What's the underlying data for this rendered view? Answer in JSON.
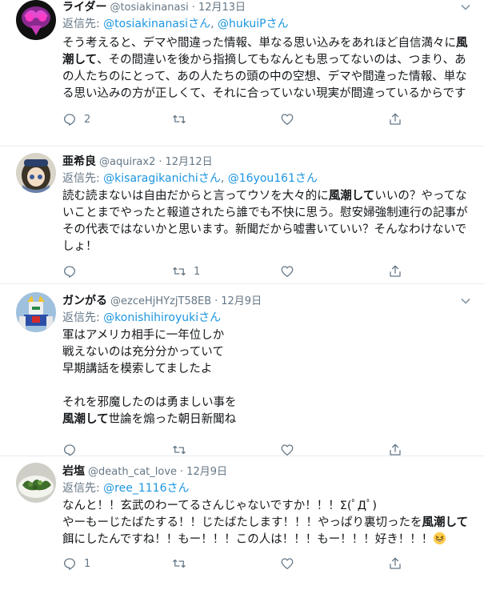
{
  "tweets": [
    {
      "name": "ライダー",
      "handle": "@tosiakinanasi",
      "date": "12月13日",
      "reply_prefix": "返信先: ",
      "reply_users": [
        "@tosiakinanasiさん",
        "@hukuiPさん"
      ],
      "reply_sep": ", ",
      "segments": [
        {
          "t": "そう考えると、デマや間違った情報、単なる思い込みをあれほど自信満々に",
          "b": false
        },
        {
          "t": "風潮して",
          "b": true
        },
        {
          "t": "、その間違いを後から指摘してもなんとも思ってないのは、つまり、あの人たちのにとって、あの人たちの頭の中の空想、デマや間違った情報、単なる思い込みの方が正しくて、それに合っていない現実が間違っているからです",
          "b": false
        }
      ],
      "reply_count": "2",
      "retweet_count": "",
      "like_count": "",
      "avatar_icon": "masked-rider-avatar-icon"
    },
    {
      "name": "亜希良",
      "handle": "@aquirax2",
      "date": "12月12日",
      "reply_prefix": "返信先: ",
      "reply_users": [
        "@kisaragikanichiさん",
        "@16you161さん"
      ],
      "reply_sep": ", ",
      "segments": [
        {
          "t": "読む読まないは自由だからと言ってウソを大々的に",
          "b": false
        },
        {
          "t": "風潮して",
          "b": true
        },
        {
          "t": "いいの？やってないことまでやったと報道されたら誰でも不快に思う。慰安婦強制連行の記事がその代表ではないかと思います。新聞だから嘘書いていい？そんなわけないでしょ！",
          "b": false
        }
      ],
      "reply_count": "",
      "retweet_count": "1",
      "like_count": "",
      "avatar_icon": "anime-girl-avatar-icon"
    },
    {
      "name": "ガンがる",
      "handle": "@ezceHjHYzjT58EB",
      "date": "12月9日",
      "reply_prefix": "返信先: ",
      "reply_users": [
        "@konishihiroyukiさん"
      ],
      "reply_sep": "",
      "segments": [
        {
          "t": "軍はアメリカ相手に一年位しか\n戦えないのは充分分かっていて\n早期講話を模索してましたよ\n\nそれを邪魔したのは勇ましい事を\n",
          "b": false
        },
        {
          "t": "風潮して",
          "b": true
        },
        {
          "t": "世論を煽った朝日新聞ね",
          "b": false
        }
      ],
      "reply_count": "",
      "retweet_count": "",
      "like_count": "",
      "avatar_icon": "gundam-robot-avatar-icon"
    },
    {
      "name": "岩塩",
      "handle": "@death_cat_love",
      "date": "12月9日",
      "reply_prefix": "返信先: ",
      "reply_users": [
        "@ree_1116さん"
      ],
      "reply_sep": "",
      "segments": [
        {
          "t": "なんと！！玄武のわーてるさんじゃないですか！！！Σ(ﾟДﾟ)\nやーもーじたばたする！！じたばたします！！！やっぱり裏切ったを",
          "b": false
        },
        {
          "t": "風潮して",
          "b": true
        },
        {
          "t": "餌にしたんですね！！もー！！！この人は！！！もー！！！好き！！！",
          "b": false
        }
      ],
      "emoji": "grinning-squinting-face-emoji",
      "reply_count": "1",
      "retweet_count": "",
      "like_count": "",
      "avatar_icon": "seaweed-food-avatar-icon"
    }
  ],
  "colors": {
    "link": "#1b95e0",
    "meta": "#657786",
    "text": "#14171a",
    "divider": "#e6ecf0"
  }
}
